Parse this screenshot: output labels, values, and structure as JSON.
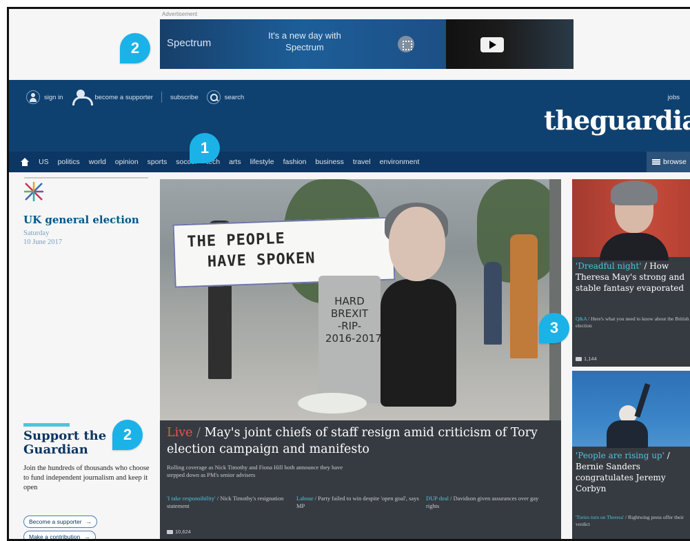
{
  "ad": {
    "label": "Advertisement",
    "brand": "Spectrum",
    "copy": "It's a new day with Spectrum"
  },
  "header": {
    "sign_in": "sign in",
    "become_supporter": "become a supporter",
    "subscribe": "subscribe",
    "search": "search",
    "jobs": "jobs",
    "logo": "theguardian"
  },
  "nav": {
    "items": [
      "US",
      "politics",
      "world",
      "opinion",
      "sports",
      "soccer",
      "tech",
      "arts",
      "lifestyle",
      "fashion",
      "business",
      "travel",
      "environment"
    ],
    "browse": "browse"
  },
  "election": {
    "title": "UK general election",
    "day": "Saturday",
    "date": "10 June 2017"
  },
  "support": {
    "title": "Support the Guardian",
    "text": "Join the hundreds of thousands who choose to fund independent journalism and keep it open",
    "become_supporter": "Become a supporter",
    "make_contribution": "Make a contribution"
  },
  "main_story": {
    "live": "Live",
    "headline": "May's joint chiefs of staff resign amid criticism of Tory election campaign and manifesto",
    "standfirst": "Rolling coverage as Nick Timothy and Fiona Hill both announce they have stepped down as PM's senior advisers",
    "sublinks": [
      {
        "kicker": "'I take responsibility'",
        "text": "Nick Timothy's resignation statement"
      },
      {
        "kicker": "Labour",
        "text": "Party failed to win despite 'open goal', says MP"
      },
      {
        "kicker": "DUP deal",
        "text": "Davidson given assurances over gay rights"
      }
    ],
    "comments": "10,624",
    "photo_sign": "THE PEOPLE\n  HAVE SPOKEN",
    "photo_tomb": "HARD\nBREXIT\n-RIP-\n2016-2017"
  },
  "right_stories": [
    {
      "kicker": "'Dreadful night'",
      "headline": "How Theresa May's strong and stable fantasy evaporated",
      "sub_kicker": "Q&A",
      "sub_text": "Here's what you need to know about the British election",
      "comments": "1,144"
    },
    {
      "kicker": "'People are rising up'",
      "headline": "Bernie Sanders congratulates Jeremy Corbyn",
      "sub_kicker": "'Tories turn on Theresa'",
      "sub_text": "Rightwing press offer their verdict"
    }
  ],
  "callouts": [
    "1",
    "2",
    "2",
    "3"
  ],
  "colors": {
    "header_blue": "#0f4170",
    "nav_blue": "#0c3663",
    "accent_cyan": "#4bc6df",
    "live_red": "#e8574a",
    "callout_blue": "#1bb2e8",
    "card_dark": "#363b41"
  }
}
